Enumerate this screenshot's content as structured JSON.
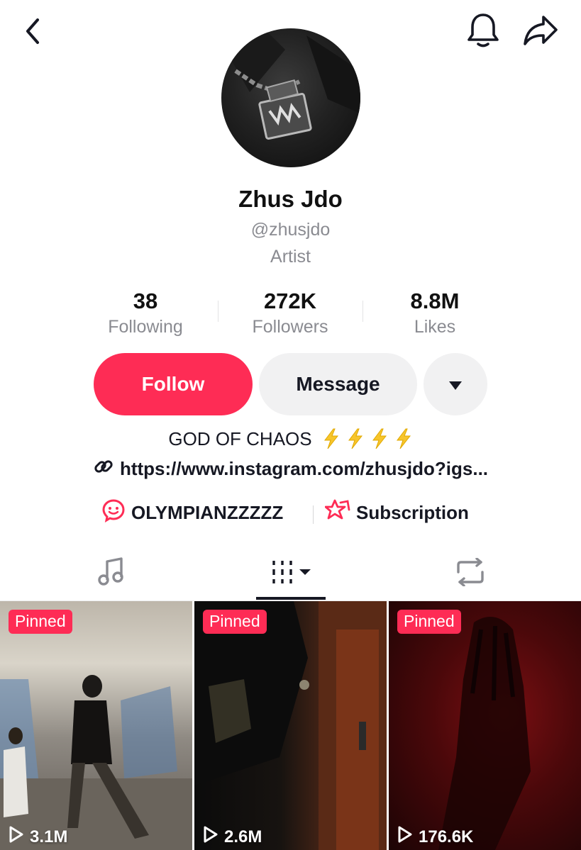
{
  "profile": {
    "display_name": "Zhus Jdo",
    "handle": "@zhusjdo",
    "category": "Artist"
  },
  "stats": [
    {
      "value": "38",
      "label": "Following"
    },
    {
      "value": "272K",
      "label": "Followers"
    },
    {
      "value": "8.8M",
      "label": "Likes"
    }
  ],
  "actions": {
    "follow_label": "Follow",
    "message_label": "Message"
  },
  "bio": {
    "text": "GOD OF CHAOS",
    "link": "https://www.instagram.com/zhusjdo?igs..."
  },
  "chips": {
    "community_label": "OLYMPIANZZZZZ",
    "subscription_label": "Subscription"
  },
  "videos": [
    {
      "badge": "Pinned",
      "views": "3.1M"
    },
    {
      "badge": "Pinned",
      "views": "2.6M"
    },
    {
      "badge": "Pinned",
      "views": "176.6K"
    }
  ],
  "colors": {
    "accent": "#fe2c55",
    "secondary_button": "#f1f1f2",
    "muted_text": "#8a8b91"
  }
}
